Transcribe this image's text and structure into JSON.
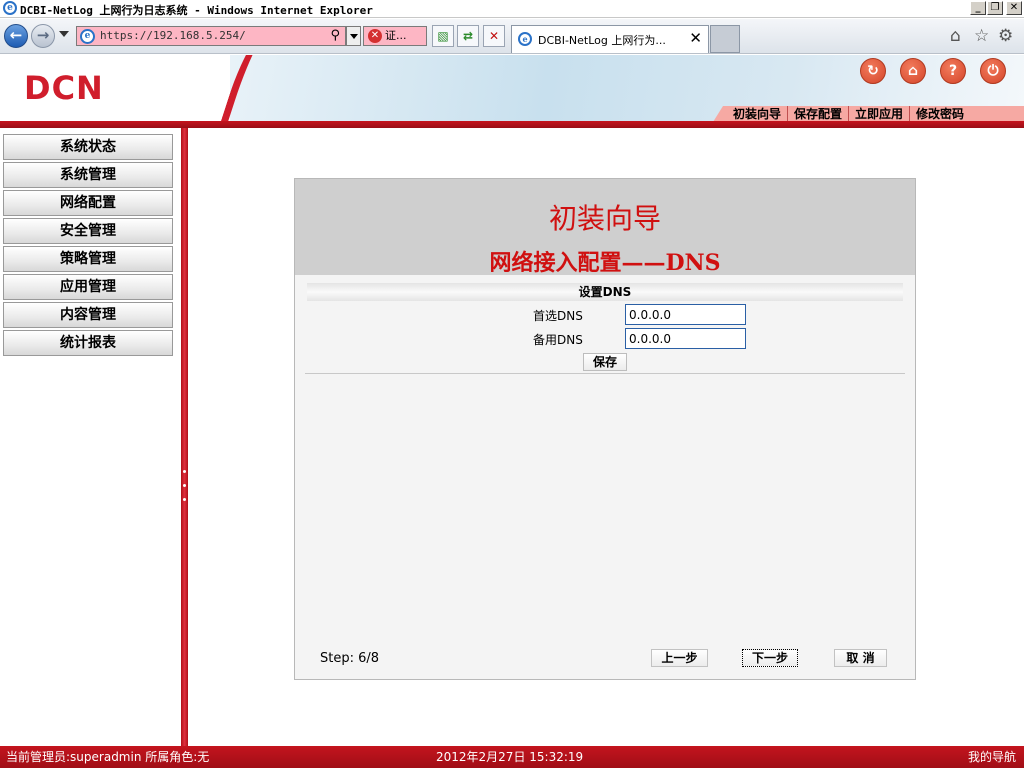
{
  "browser": {
    "window_title": "DCBI-NetLog 上网行为日志系统 - Windows Internet Explorer",
    "address": "https://192.168.5.254/",
    "cert_label": "证...",
    "tab_label": "DCBI-NetLog 上网行为...",
    "window_buttons": {
      "minimize": "_",
      "maximize": "❐",
      "close": "✕"
    }
  },
  "header": {
    "logo": "DCN",
    "quick_links": [
      "初装向导",
      "保存配置",
      "立即应用",
      "修改密码"
    ],
    "icons": [
      "refresh-icon",
      "home-icon",
      "help-icon",
      "logout-icon"
    ]
  },
  "sidebar": {
    "items": [
      "系统状态",
      "系统管理",
      "网络配置",
      "安全管理",
      "策略管理",
      "应用管理",
      "内容管理",
      "统计报表"
    ]
  },
  "wizard": {
    "title": "初装向导",
    "subtitle": "网络接入配置——DNS",
    "section_title": "设置DNS",
    "primary_dns_label": "首选DNS",
    "primary_dns_value": "0.0.0.0",
    "secondary_dns_label": "备用DNS",
    "secondary_dns_value": "0.0.0.0",
    "save_label": "保存",
    "step": "Step: 6/8",
    "prev_label": "上一步",
    "next_label": "下一步",
    "cancel_label": "取 消"
  },
  "status": {
    "user": "当前管理员:superadmin  所属角色:无",
    "time": "2012年2月27日 15:32:19",
    "nav": "我的导航"
  },
  "colors": {
    "brand_red": "#d01e2c",
    "title_red": "#d01010",
    "statusbar_red": "#b01018",
    "quicklink_pink": "#f6a9a3",
    "address_pink": "#fdb6c4"
  }
}
